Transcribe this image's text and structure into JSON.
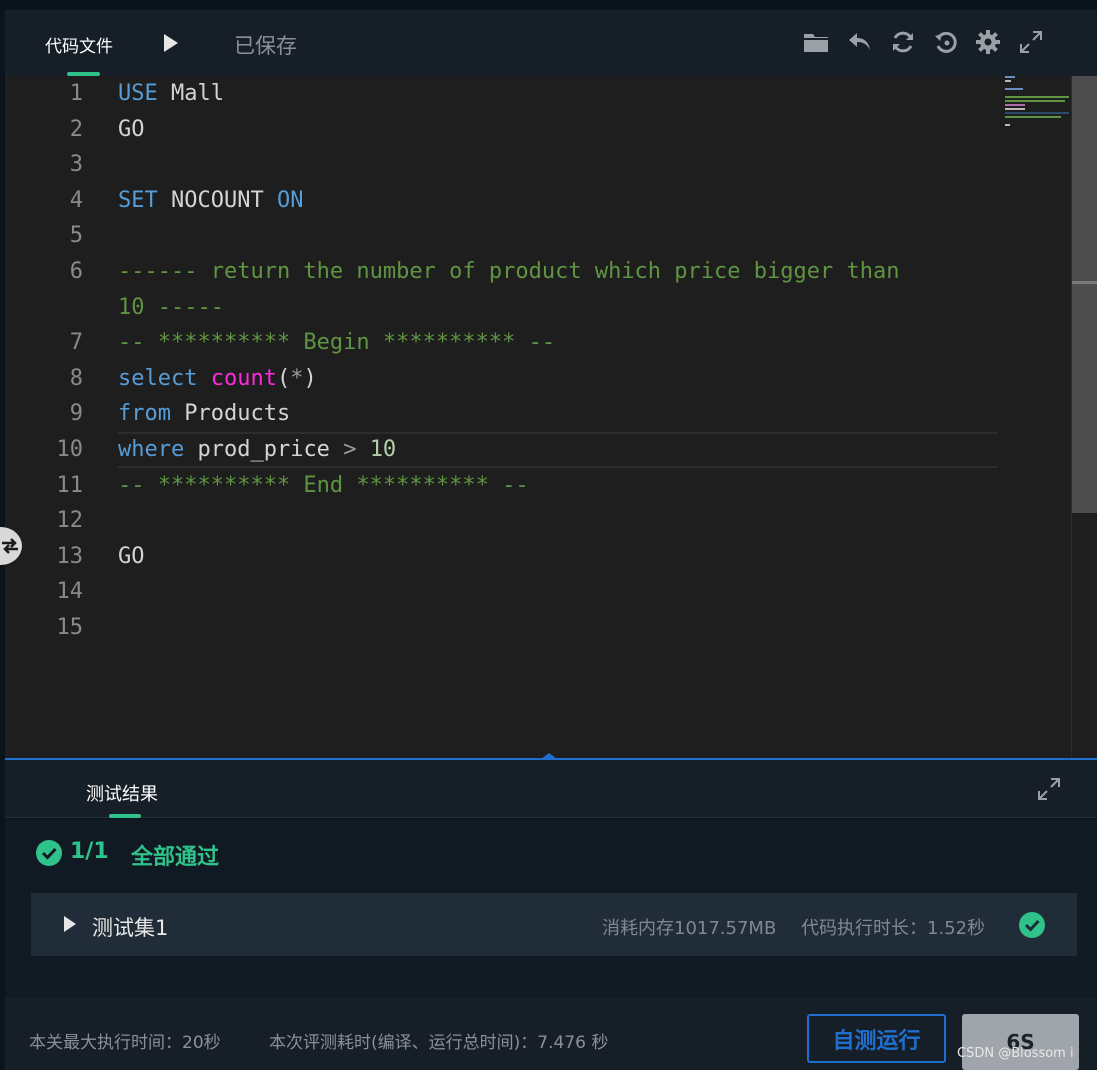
{
  "toolbar": {
    "file_tab": "代码文件",
    "saved": "已保存"
  },
  "editor": {
    "lines": [
      {
        "n": "1",
        "tokens": [
          [
            "kw",
            "USE"
          ],
          [
            "txt",
            " Mall"
          ]
        ]
      },
      {
        "n": "2",
        "tokens": [
          [
            "txt",
            "GO"
          ]
        ]
      },
      {
        "n": "3",
        "tokens": []
      },
      {
        "n": "4",
        "tokens": [
          [
            "kw",
            "SET"
          ],
          [
            "txt",
            " NOCOUNT "
          ],
          [
            "kw",
            "ON"
          ]
        ]
      },
      {
        "n": "5",
        "tokens": []
      },
      {
        "n": "6",
        "tokens": [
          [
            "cm",
            "------ return the number of product which price bigger than"
          ]
        ]
      },
      {
        "n": "",
        "tokens": [
          [
            "cm",
            "10 -----"
          ]
        ]
      },
      {
        "n": "7",
        "tokens": [
          [
            "cm",
            "-- ********** Begin ********** --"
          ]
        ]
      },
      {
        "n": "8",
        "tokens": [
          [
            "kw",
            "select"
          ],
          [
            "txt",
            " "
          ],
          [
            "fn",
            "count"
          ],
          [
            "txt",
            "("
          ],
          [
            "op",
            "*"
          ],
          [
            "txt",
            ")"
          ]
        ]
      },
      {
        "n": "9",
        "tokens": [
          [
            "kw",
            "from"
          ],
          [
            "txt",
            " Products"
          ]
        ]
      },
      {
        "n": "10",
        "tokens": [
          [
            "kw",
            "where"
          ],
          [
            "txt",
            " prod_price "
          ],
          [
            "op",
            ">"
          ],
          [
            "txt",
            " "
          ],
          [
            "num",
            "10"
          ]
        ]
      },
      {
        "n": "11",
        "tokens": [
          [
            "cm",
            "-- ********** End ********** --"
          ]
        ]
      },
      {
        "n": "12",
        "tokens": []
      },
      {
        "n": "13",
        "tokens": [
          [
            "txt",
            "GO"
          ]
        ]
      },
      {
        "n": "14",
        "tokens": []
      },
      {
        "n": "15",
        "tokens": []
      }
    ]
  },
  "results": {
    "title": "测试结果",
    "pass_count": "1/1",
    "pass_text": "全部通过",
    "testset": {
      "name": "测试集1",
      "memory": "消耗内存1017.57MB",
      "exec_time": "代码执行时长：1.52秒"
    }
  },
  "footer": {
    "max_time": "本关最大执行时间：20秒",
    "total_time": "本次评测耗时(编译、运行总时间)：7.476 秒",
    "self_test_button": "自测运行",
    "submit_button": "6S",
    "watermark": "CSDN @Blossom i"
  },
  "colors": {
    "accent_green": "#2fc28a",
    "accent_blue": "#1f6fd1",
    "keyword": "#569cd6",
    "function": "#ff2adf",
    "comment": "#5f9442",
    "number": "#b5cea8"
  },
  "icons": {
    "run": "play-icon",
    "toolbar": [
      "folder-icon",
      "undo-icon",
      "refresh-icon",
      "restore-icon",
      "settings-icon",
      "fullscreen-icon"
    ],
    "pass": "check-circle-icon"
  }
}
